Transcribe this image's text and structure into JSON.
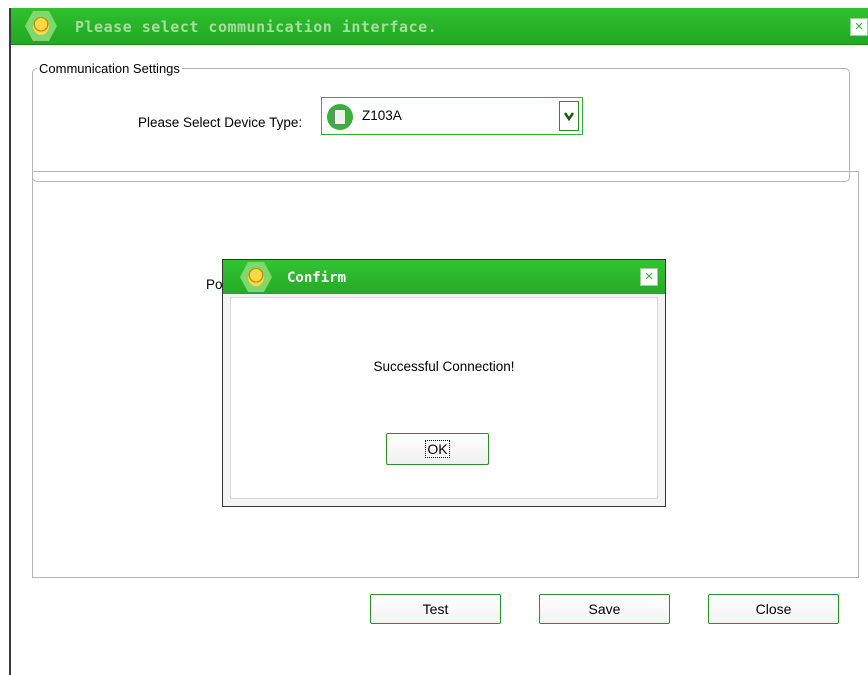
{
  "window": {
    "title": "Please select communication interface.",
    "close_icon": "×"
  },
  "communication": {
    "group_title": "Communication Settings",
    "device_label": "Please Select Device Type:",
    "device_value": "Z103A",
    "dropdown_icon": "⌄"
  },
  "panel": {
    "partial_label": "Po"
  },
  "buttons": {
    "test": "Test",
    "save": "Save",
    "close": "Close"
  },
  "dialog": {
    "title": "Confirm",
    "message": "Successful Connection!",
    "ok_label": "OK",
    "close_icon": "×"
  },
  "colors": {
    "titlebar_green": "#22a722",
    "accent_green": "#2fb52f"
  }
}
